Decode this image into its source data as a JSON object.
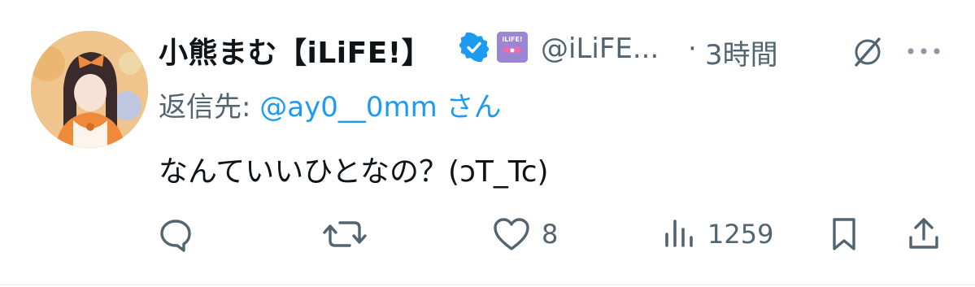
{
  "tweet": {
    "author": {
      "display_name": "小熊まむ【iLiFE!】",
      "handle": "@iLiFE...",
      "verified": true,
      "affiliation_badge_text": "iLiFE!"
    },
    "separator": "·",
    "timestamp": "3時間",
    "reply_to": {
      "prefix": "返信先: ",
      "mention": "@ay0__0mm",
      "suffix": " さん"
    },
    "text": "なんていいひとなの？(ↄT_Tc)",
    "metrics": {
      "replies": "",
      "retweets": "",
      "likes": "8",
      "views": "1259"
    }
  },
  "colors": {
    "text_primary": "#0f1419",
    "text_secondary": "#536471",
    "link": "#1d9bf0",
    "verified_badge": "#1d9bf0"
  },
  "icons": [
    "avatar",
    "verified-badge-icon",
    "affiliation-badge-icon",
    "grok-icon",
    "more-icon",
    "reply-icon",
    "retweet-icon",
    "like-icon",
    "views-icon",
    "bookmark-icon",
    "share-icon"
  ]
}
